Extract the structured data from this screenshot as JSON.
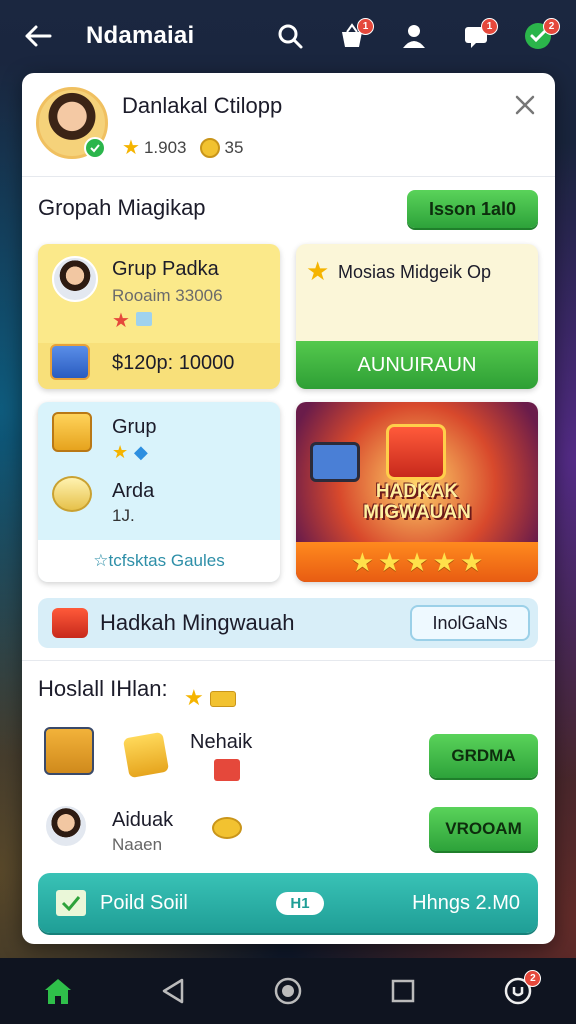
{
  "header": {
    "title": "Ndamaiai",
    "notification_count": "1",
    "gift_count": "1",
    "shield_count": "2"
  },
  "profile": {
    "name": "Danlakal Ctilopp",
    "stars": "1.903",
    "coins": "35"
  },
  "section_groups": {
    "heading": "Gropah Miagikap",
    "action_label": "Isson 1al0"
  },
  "tile_group": {
    "title": "Grup Padka",
    "subtitle": "Rooaim 33006",
    "price": "$120p: 10000"
  },
  "tile_mission": {
    "title": "Mosias Midgeik Op",
    "button_label": "AUNUIRAUN"
  },
  "tile_rewards": {
    "item1": "Grup",
    "item2": "Arda",
    "item2_sub": "1J.",
    "footer": "☆tcfsktas Gaules"
  },
  "tile_game": {
    "title_line1": "HADKAK",
    "title_line2": "MIGWAUAN",
    "rating": 5
  },
  "banner": {
    "text": "Hadkah Mingwauah",
    "button_label": "InolGaNs"
  },
  "section_hot": {
    "heading": "Hoslall IHlan:"
  },
  "rows": [
    {
      "title": "Nehaik",
      "button_label": "GRDMA"
    },
    {
      "title": "Aiduak",
      "subtitle": "Naaen",
      "button_label": "VROOAM"
    }
  ],
  "cta": {
    "left": "Poild Soiil",
    "pill": "H1",
    "right": "Hhngs 2.M0"
  },
  "nav": {
    "home": "home-icon",
    "back": "back-triangle-icon",
    "circle": "home-circle-icon",
    "square": "recents-square-icon",
    "profile": "profile-icon",
    "profile_badge": "2"
  },
  "colors": {
    "accent_green": "#2da23a",
    "teal": "#1f9e96",
    "orange": "#e85c12",
    "yellow": "#fbe98a"
  }
}
